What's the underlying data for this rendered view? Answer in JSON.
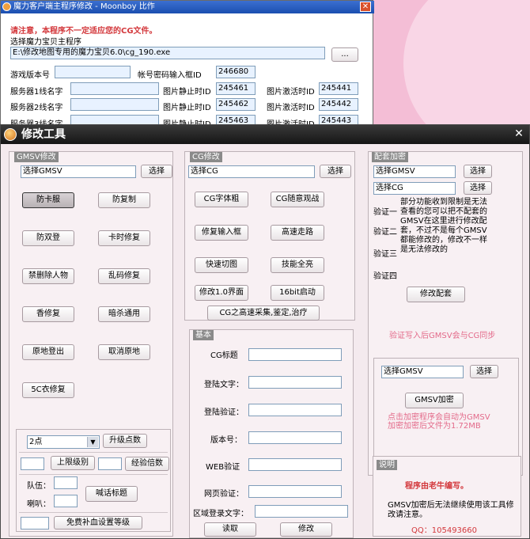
{
  "bg_window": {
    "title": "魔力客户端主程序修改 - Moonboy ⽐作",
    "close": "✕",
    "warning": "请注意，本程序不一定适应您的CG文件。",
    "choose_main_label": "选择魔力宝贝主程序",
    "path_value": "E:\\修改地图专用的魔力宝贝6.0\\cg_190.exe",
    "browse_label": "...",
    "game_version_label": "游戏版本号",
    "password_frame_label": "帐号密码输入框ID",
    "password_frame_id": "246680",
    "server_rows": [
      {
        "name_label": "服务器1线名字",
        "static_label": "图片静止时ID",
        "static_id": "245461",
        "active_label": "图片激活时ID",
        "active_id": "245441"
      },
      {
        "name_label": "服务器2线名字",
        "static_label": "图片静止时ID",
        "static_id": "245462",
        "active_label": "图片激活时ID",
        "active_id": "245442"
      },
      {
        "name_label": "服务器3线名字",
        "static_label": "图片静止时ID",
        "static_id": "245463",
        "active_label": "图片激活时ID",
        "active_id": "245443"
      }
    ]
  },
  "main_window": {
    "title": "修改工具",
    "close": "✕",
    "gmsv_group": {
      "header": "GMSV修改",
      "field_value": "选择GMSV",
      "select_button": "选择",
      "buttons": [
        "防卡服",
        "防复制",
        "防双登",
        "卡时修复",
        "禁删除人物",
        "乱码修复",
        "香修复",
        "暗杀通用",
        "原地登出",
        "取消原地",
        "5C衣修复"
      ],
      "upgrade_select_value": "2点",
      "upgrade_button": "升级点数",
      "level_cap_button": "上限级别",
      "exp_rate_button": "经验倍数",
      "team_label": "队伍：",
      "horn_label": "喇叭：",
      "shout_title_button": "喊话标题",
      "free_heal_button": "免费补血设置等级"
    },
    "cg_group": {
      "header": "CG修改",
      "field_value": "选择CG",
      "select_button": "选择",
      "buttons": [
        "CG字体粗",
        "CG随意观战",
        "修复输入框",
        "高速走路",
        "快速切图",
        "技能全亮",
        "修改1.0界面",
        "16bit启动"
      ],
      "wide_button": "CG之高速采集,鉴定,治疗"
    },
    "basic_group": {
      "header": "基本",
      "fields": [
        "CG标题",
        "登陆文字：",
        "登陆验证：",
        "版本号：",
        "WEB验证",
        "网页验证："
      ],
      "region_label": "区域登录文字：",
      "read_button": "读取",
      "modify_button": "修改"
    },
    "pair_group": {
      "header": "配套加密",
      "gmsv_value": "选择GMSV",
      "cg_value": "选择CG",
      "select_button": "选择",
      "verify_labels": [
        "验证一",
        "验证二",
        "验证三",
        "验证四"
      ],
      "info_text": "部分功能收到限制是无法查看的您可以把不配套的GMSV在这里进行修改配套，不过不是每个GMSV都能修改的，修改不一样是无法修改的",
      "modify_pair_button": "修改配套",
      "verify_note": "验证写入后GMSV会与CG同步"
    },
    "encrypt_group": {
      "gmsv_value": "选择GMSV",
      "select_button": "选择",
      "encrypt_button": "GMSV加密",
      "note": "点击加密程序会自动为GMSV加密加密后文件为1.72MB"
    },
    "about_group": {
      "header": "说明",
      "author": "程序由老牛编写。",
      "notice": "GMSV加密后无法继续使用该工具修改请注意。",
      "qq": "QQ：105493660"
    }
  },
  "colors": {
    "warning": "#d3383c",
    "note": "#e36a8a",
    "title_bg": "#1e1e1e",
    "accent_blue": "#1b4fb0"
  }
}
